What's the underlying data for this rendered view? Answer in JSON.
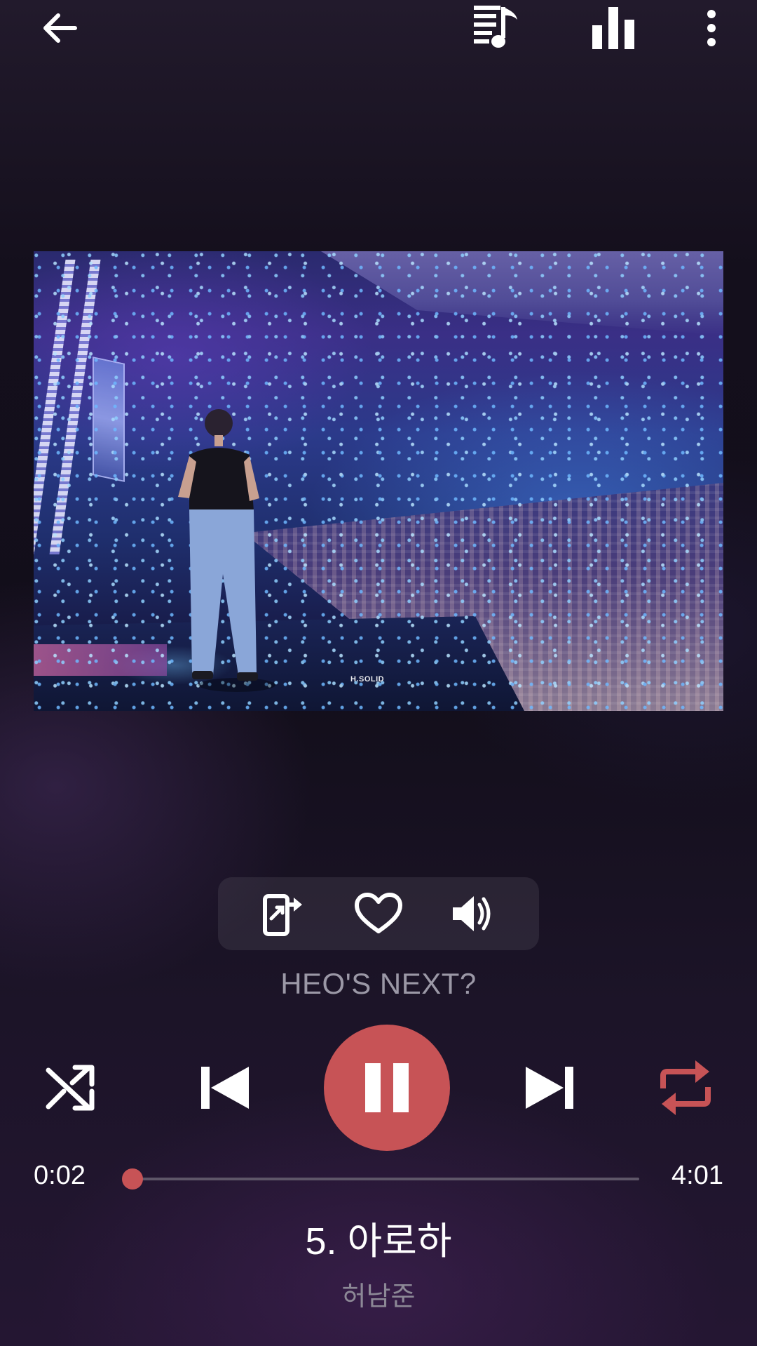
{
  "header": {
    "back_icon": "arrow-left-icon",
    "queue_icon": "playlist-music-icon",
    "equalizer_icon": "bar-chart-icon",
    "menu_icon": "more-vertical-icon"
  },
  "artwork": {
    "watermark": "H.SOLID"
  },
  "actions": {
    "cast_icon": "phone-share-icon",
    "favorite_icon": "heart-outline-icon",
    "volume_icon": "volume-icon"
  },
  "next_hint": "HEO'S NEXT?",
  "controls": {
    "shuffle_icon": "shuffle-icon",
    "previous_icon": "skip-previous-icon",
    "pause_icon": "pause-icon",
    "next_icon": "skip-next-icon",
    "repeat_icon": "repeat-icon"
  },
  "progress": {
    "elapsed": "0:02",
    "duration": "4:01",
    "fraction": 0.008
  },
  "track": {
    "title": "5. 아로하",
    "artist": "허남준"
  },
  "colors": {
    "accent": "#c75356",
    "background": "#140f1c",
    "muted_text": "#9b98a6"
  }
}
